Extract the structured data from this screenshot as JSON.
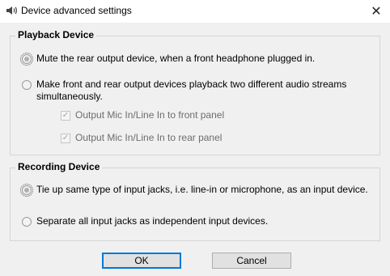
{
  "window": {
    "title": "Device advanced settings",
    "close_glyph": "✕"
  },
  "playback": {
    "legend": "Playback Device",
    "option1": {
      "label": "Mute the rear output device, when a front headphone plugged in.",
      "selected": true
    },
    "option2": {
      "line1": "Make front and rear output devices playback two different audio streams",
      "line2": "simultaneously.",
      "selected": false
    },
    "check_front": {
      "label": "Output Mic In/Line In to front panel",
      "checked": true,
      "enabled": false
    },
    "check_rear": {
      "label": "Output Mic In/Line In to rear panel",
      "checked": true,
      "enabled": false
    }
  },
  "recording": {
    "legend": "Recording Device",
    "option1": {
      "label": "Tie up same type of input jacks, i.e. line-in or microphone, as an input device.",
      "selected": true
    },
    "option2": {
      "label": "Separate all input jacks as independent input devices.",
      "selected": false
    }
  },
  "buttons": {
    "ok": "OK",
    "cancel": "Cancel"
  },
  "icons": {
    "title": "speaker-icon",
    "check": "✓"
  }
}
